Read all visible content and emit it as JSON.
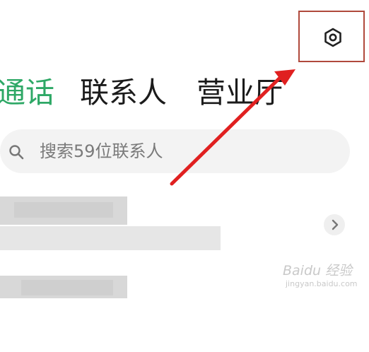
{
  "tabs": [
    {
      "label": "通话",
      "active": true
    },
    {
      "label": "联系人",
      "active": false
    },
    {
      "label": "营业厅",
      "active": false
    }
  ],
  "search": {
    "placeholder": "搜索59位联系人"
  },
  "icons": {
    "settings": "settings-hexagon-icon",
    "search": "search-icon",
    "chevron": "chevron-right-icon"
  },
  "annotation": {
    "highlight_color": "#b0493c",
    "arrow_color": "#e02020"
  },
  "watermark": {
    "logo": "Baidu 经验",
    "url": "jingyan.baidu.com"
  },
  "colors": {
    "accent": "#2ea866",
    "text": "#1b1b1b",
    "muted": "#7a7a7a"
  }
}
